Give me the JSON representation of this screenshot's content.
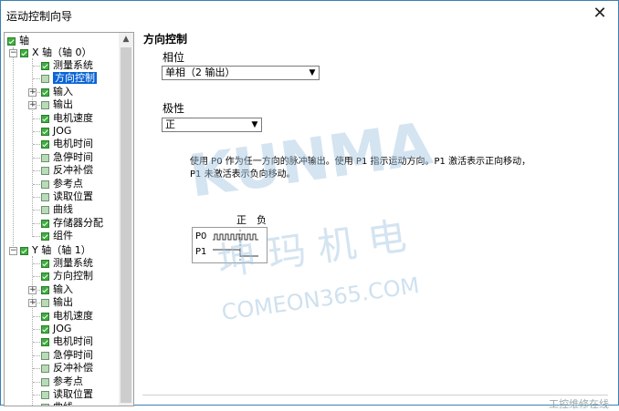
{
  "window": {
    "title": "运动控制向导",
    "close_glyph": "✕"
  },
  "tree": {
    "root_label": "轴",
    "x_axis": {
      "label": "X 轴（轴 0）",
      "items": [
        "测量系统",
        "方向控制",
        "输入",
        "输出",
        "电机速度",
        "JOG",
        "电机时间",
        "急停时间",
        "反冲补偿",
        "参考点",
        "读取位置",
        "曲线",
        "存储器分配",
        "组件"
      ]
    },
    "y_axis": {
      "label": "Y 轴（轴 1）",
      "items": [
        "测量系统",
        "方向控制",
        "输入",
        "输出",
        "电机速度",
        "JOG",
        "电机时间",
        "急停时间",
        "反冲补偿",
        "参考点",
        "读取位置",
        "曲线"
      ]
    }
  },
  "panel": {
    "title": "方向控制",
    "phase_label": "相位",
    "phase_value": "单相（2 输出）",
    "polarity_label": "极性",
    "polarity_value": "正",
    "description_line1": "使用 P0 作为任一方向的脉冲输出。使用 P1 指示运动方向。P1 激活表示正向移动，",
    "description_line2": "P1 未激活表示负向移动。",
    "signal_pos": "正",
    "signal_neg": "负",
    "signal_p0": "P0",
    "signal_p1": "P1"
  },
  "watermark": {
    "brand": "KUNMA",
    "cn_text": "坤 玛 机 电",
    "site": "COMEON365.COM",
    "footer": "工控维修在线"
  }
}
